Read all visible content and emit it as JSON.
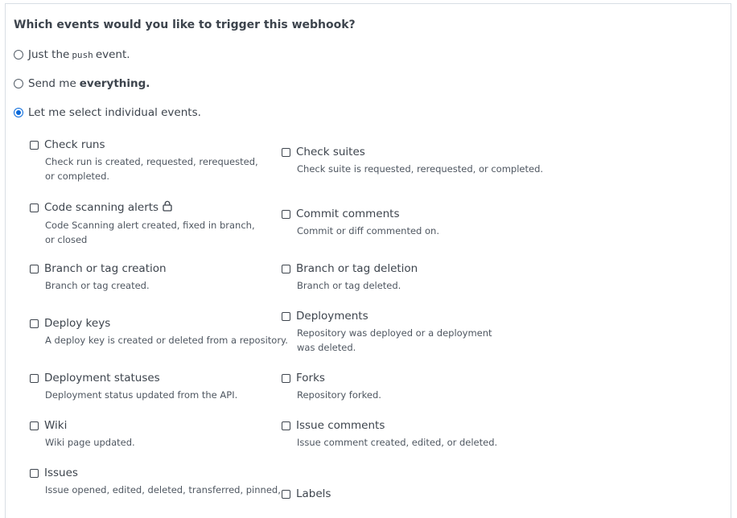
{
  "question": "Which events would you like to trigger this webhook?",
  "options": {
    "push_prefix": "Just the",
    "push_code": "push",
    "push_suffix": "event.",
    "everything_prefix": "Send me",
    "everything_bold": "everything.",
    "individual": "Let me select individual events."
  },
  "selected_option": "individual",
  "events": {
    "check_runs": {
      "title": "Check runs",
      "desc": "Check run is created, requested, rerequested, or completed."
    },
    "check_suites": {
      "title": "Check suites",
      "desc": "Check suite is requested, rerequested, or completed."
    },
    "code_scanning": {
      "title": "Code scanning alerts",
      "desc": "Code Scanning alert created, fixed in branch, or closed",
      "icon": "lock-icon"
    },
    "commit_comments": {
      "title": "Commit comments",
      "desc": "Commit or diff commented on."
    },
    "branch_tag_creation": {
      "title": "Branch or tag creation",
      "desc": "Branch or tag created."
    },
    "branch_tag_deletion": {
      "title": "Branch or tag deletion",
      "desc": "Branch or tag deleted."
    },
    "deploy_keys": {
      "title": "Deploy keys",
      "desc": "A deploy key is created or deleted from a repository."
    },
    "deployments": {
      "title": "Deployments",
      "desc": "Repository was deployed or a deployment was deleted."
    },
    "deployment_statuses": {
      "title": "Deployment statuses",
      "desc": "Deployment status updated from the API."
    },
    "forks": {
      "title": "Forks",
      "desc": "Repository forked."
    },
    "wiki": {
      "title": "Wiki",
      "desc": "Wiki page updated."
    },
    "issue_comments": {
      "title": "Issue comments",
      "desc": "Issue comment created, edited, or deleted."
    },
    "issues": {
      "title": "Issues",
      "desc": "Issue opened, edited, deleted, transferred, pinned,"
    },
    "labels": {
      "title": "Labels",
      "desc": ""
    }
  },
  "colors": {
    "accent": "#0969da",
    "text": "#3d444d",
    "muted": "#4e5660",
    "border": "#d8dee4"
  }
}
